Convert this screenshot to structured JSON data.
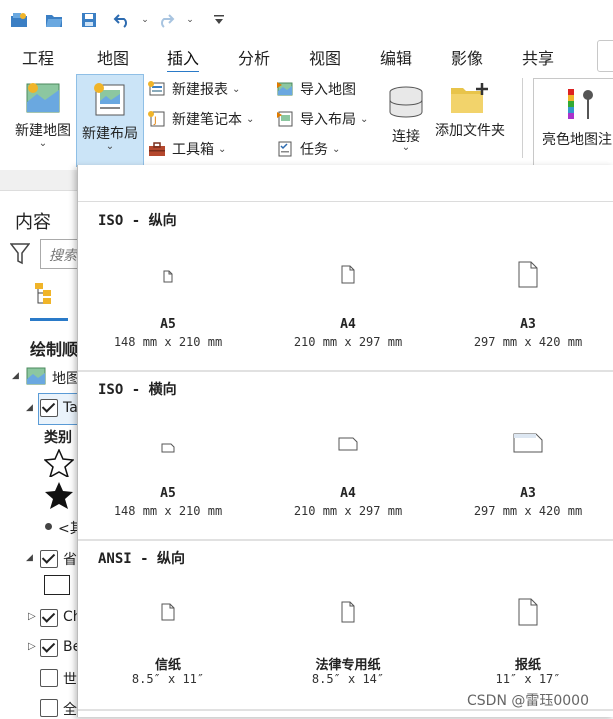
{
  "menu": [
    "工程",
    "地图",
    "插入",
    "分析",
    "视图",
    "编辑",
    "影像",
    "共享"
  ],
  "menu_active_index": 2,
  "ribbon": {
    "new_map": "新建地图",
    "new_layout": "新建布局",
    "new_report": "新建报表",
    "new_notebook": "新建笔记本",
    "toolbox": "工具箱",
    "import_map": "导入地图",
    "import_layout": "导入布局",
    "task": "任务",
    "connect": "连接",
    "add_folder": "添加文件夹",
    "bright_map_note": "亮色地图注"
  },
  "left_pane": {
    "title": "内容",
    "search_placeholder": "搜索",
    "draw_order": "绘制顺",
    "map_item": "地图",
    "layer_ta": "Ta",
    "category": "类别",
    "other": "<其",
    "province": "省",
    "layer_ch": "Ch",
    "layer_be": "Be",
    "world": "世",
    "all": "全"
  },
  "gallery": {
    "sections": [
      {
        "heading": "ISO - 纵向",
        "tiles": [
          {
            "name": "A5",
            "size": "148 mm x 210 mm"
          },
          {
            "name": "A4",
            "size": "210 mm x 297 mm"
          },
          {
            "name": "A3",
            "size": "297 mm x 420 mm"
          }
        ]
      },
      {
        "heading": "ISO - 横向",
        "tiles": [
          {
            "name": "A5",
            "size": "148 mm x 210 mm"
          },
          {
            "name": "A4",
            "size": "210 mm x 297 mm"
          },
          {
            "name": "A3",
            "size": "297 mm x 420 mm"
          }
        ]
      },
      {
        "heading": "ANSI - 纵向",
        "tiles": [
          {
            "name": "信纸",
            "size": "8.5″ x 11″"
          },
          {
            "name": "法律专用纸",
            "size": "8.5″ x 14″"
          },
          {
            "name": "报纸",
            "size": "11″ x 17″"
          }
        ]
      }
    ]
  },
  "watermark": "CSDN @雷珏0000",
  "colors": {
    "accent": "#2a7ac8",
    "selected_bg": "#cbe4f7"
  }
}
